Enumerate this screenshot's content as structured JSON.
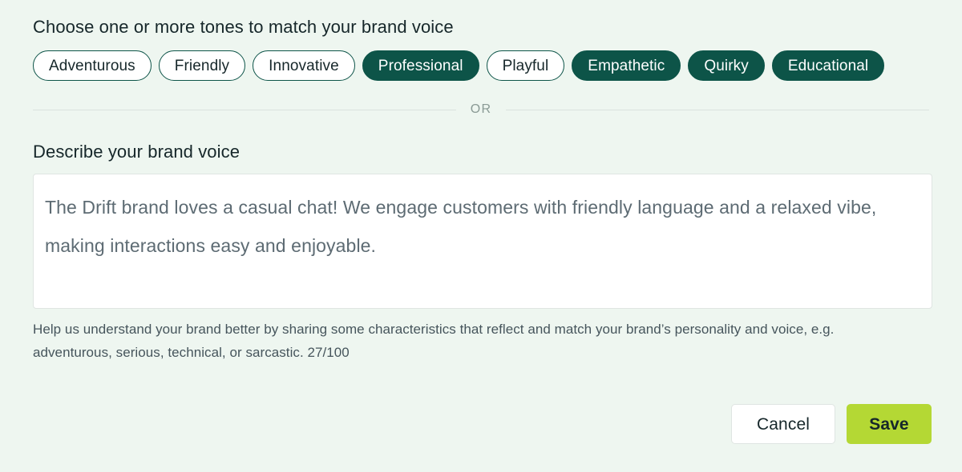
{
  "tones": {
    "heading": "Choose one or more tones to match your brand voice",
    "options": [
      {
        "label": "Adventurous",
        "selected": false
      },
      {
        "label": "Friendly",
        "selected": false
      },
      {
        "label": "Innovative",
        "selected": false
      },
      {
        "label": "Professional",
        "selected": true
      },
      {
        "label": "Playful",
        "selected": false
      },
      {
        "label": "Empathetic",
        "selected": true
      },
      {
        "label": "Quirky",
        "selected": true
      },
      {
        "label": "Educational",
        "selected": true
      }
    ]
  },
  "divider": {
    "label": "OR"
  },
  "describe": {
    "heading": "Describe your brand voice",
    "value": "The Drift brand loves a casual chat! We engage customers with friendly language and a relaxed vibe, making interactions easy and enjoyable.",
    "placeholder": "Describe your brand voice",
    "helper_text": "Help us understand your brand better by sharing some characteristics that reflect and match your brand’s personality and voice, e.g. adventurous, serious, technical, or sarcastic. 27/100",
    "char_count": "27/100"
  },
  "footer": {
    "cancel_label": "Cancel",
    "save_label": "Save"
  },
  "colors": {
    "page_background": "#eef6f0",
    "chip_selected": "#0d5448",
    "chip_border": "#0d5448",
    "save_button": "#b4d834",
    "text_primary": "#16272a",
    "text_muted": "#5d6b73",
    "divider_line": "#d9e2dd"
  }
}
